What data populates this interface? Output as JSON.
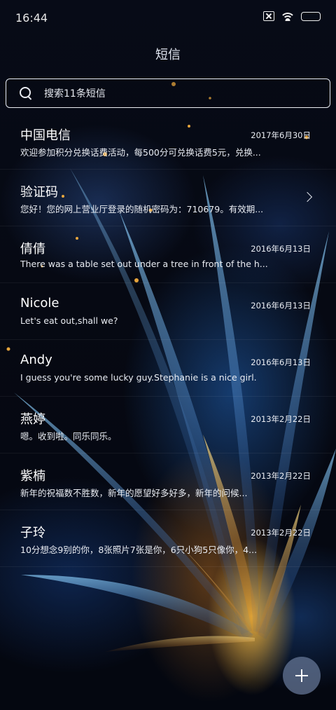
{
  "status_bar": {
    "time": "16:44",
    "icons": [
      "sim-off-icon",
      "wifi-icon",
      "battery-icon"
    ]
  },
  "header": {
    "title": "短信"
  },
  "search": {
    "placeholder": "搜索11条短信"
  },
  "conversations": [
    {
      "name": "中国电信",
      "date": "2017年6月30日",
      "preview": "欢迎参加积分兑换话费活动，每500分可兑换话费5元，兑换..."
    },
    {
      "name": "验证码",
      "date": "",
      "preview": "您好！您的网上营业厅登录的随机密码为：710679。有效期...",
      "has_chevron": true
    },
    {
      "name": "倩倩",
      "date": "2016年6月13日",
      "preview": "There was a table set out under a tree in front of the h..."
    },
    {
      "name": "Nicole",
      "date": "2016年6月13日",
      "preview": "Let's eat out,shall we?"
    },
    {
      "name": "Andy",
      "date": "2016年6月13日",
      "preview": "I guess you're some lucky guy.Stephanie is a nice girl."
    },
    {
      "name": "燕婷",
      "date": "2013年2月22日",
      "preview": "嗯。收到啦。同乐同乐。"
    },
    {
      "name": "紫楠",
      "date": "2013年2月22日",
      "preview": "新年的祝福数不胜数，新年的愿望好多好多，新年的问候..."
    },
    {
      "name": "子玲",
      "date": "2013年2月22日",
      "preview": "10分想念9别的你，8张照片7张是你，6只小狗5只像你，4..."
    }
  ],
  "fab": {
    "icon": "plus-icon"
  },
  "colors": {
    "fab_bg": "#647696",
    "text": "#ffffff"
  }
}
